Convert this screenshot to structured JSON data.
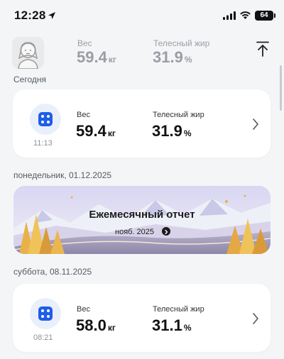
{
  "status_bar": {
    "time": "12:28",
    "battery": "64"
  },
  "header": {
    "weight_label": "Вес",
    "weight_value": "59.4",
    "weight_unit": "кг",
    "fat_label": "Телесный жир",
    "fat_value": "31.9",
    "fat_unit": "%"
  },
  "sections": {
    "today_label": "Сегодня",
    "monday_label": "понедельник, 01.12.2025",
    "saturday_label": "суббота, 08.11.2025"
  },
  "records": [
    {
      "time": "11:13",
      "weight_label": "Вес",
      "weight_value": "59.4",
      "weight_unit": "кг",
      "fat_label": "Телесный жир",
      "fat_value": "31.9",
      "fat_unit": "%"
    },
    {
      "time": "08:21",
      "weight_label": "Вес",
      "weight_value": "58.0",
      "weight_unit": "кг",
      "fat_label": "Телесный жир",
      "fat_value": "31.1",
      "fat_unit": "%"
    }
  ],
  "monthly_report": {
    "title": "Ежемесячный отчет",
    "period": "нояб. 2025"
  },
  "colors": {
    "accent_blue": "#1e5de8",
    "background": "#f4f5f7",
    "muted_text": "#9a9da3"
  }
}
